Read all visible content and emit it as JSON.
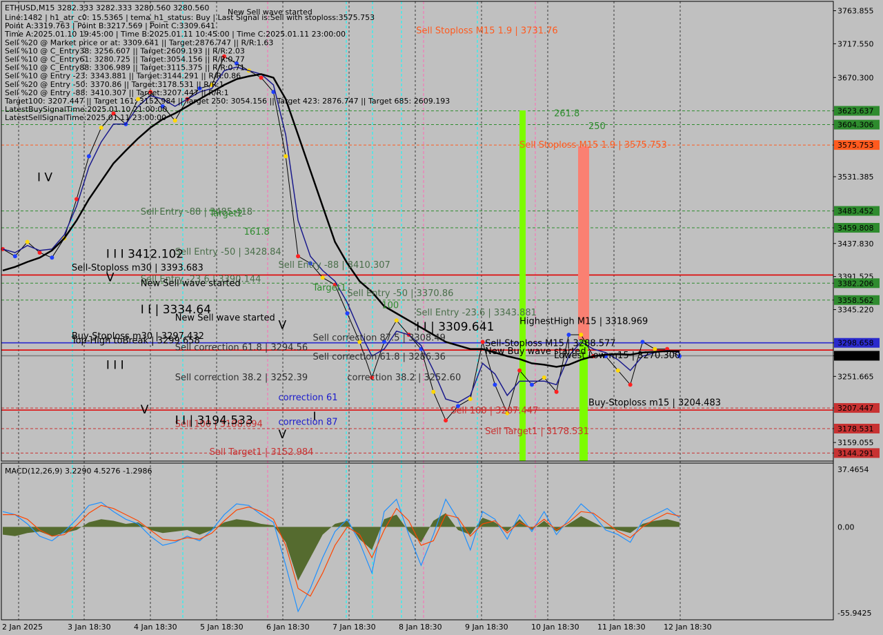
{
  "header": {
    "title": "ETHUSD,M15  3282.333 3282.333 3280.560 3280.560",
    "wave_label": "New Sell wave started",
    "info_lines": [
      "Line:1482 | h1_atr_c0: 15.5365 | tema_h1_status: Buy | Last Signal is:Sell with stoploss:3575.753",
      "Point A:3319.763 | Point B:3217.569 | Point C:3309.641",
      "Time A:2025.01.10 19:45:00 | Time B:2025.01.11 10:45:00 | Time C:2025.01.11 23:00:00",
      "Sell %20 @ Market price or at: 3309.641 || Target:2876.747 || R/R:1.63",
      "Sell %10 @ C_Entry38: 3256.607 || Target:2609.193 || R/R:2.03",
      "Sell %10 @ C_Entry61: 3280.725 || Target:3054.156 || R/R:0.77",
      "Sell %10 @ C_Entry88: 3306.989 || Target:3115.375 || R/R:0.71",
      "Sell %10 @ Entry -23: 3343.881 || Target:3144.291 || R/R:0.86",
      "Sell %20 @ Entry -50: 3370.86 || Target:3178.531 || R/R:1",
      "Sell %20 @ Entry -88: 3410.307 || Target:3207.447 || R/R:1",
      "Target100: 3207.447 || Target 161: 3152.984 || Target 250: 3054.156 || Target 423: 2876.747 || Target 685: 2609.193",
      "LatestBuySignalTime:2025.01.10 21:00:00",
      "LatestSellSignalTime:2025.01.11 23:00:00"
    ]
  },
  "price_scale": {
    "ticks": [
      "3763.855",
      "3717.550",
      "3670.300",
      "3623.637",
      "3604.306",
      "3575.753",
      "3531.385",
      "3483.452",
      "3459.808",
      "3437.830",
      "3391.525",
      "3382.206",
      "3358.562",
      "3345.220",
      "3298.658",
      "3280.560",
      "3251.665",
      "3207.447",
      "3178.531",
      "3159.055",
      "3144.291"
    ],
    "tags": [
      {
        "text": "3623.637",
        "color": "#2e8b2e"
      },
      {
        "text": "3604.306",
        "color": "#2e8b2e"
      },
      {
        "text": "3575.753",
        "color": "#ff5a1e"
      },
      {
        "text": "3483.452",
        "color": "#2e8b2e"
      },
      {
        "text": "3459.808",
        "color": "#2e8b2e"
      },
      {
        "text": "3382.206",
        "color": "#2e8b2e"
      },
      {
        "text": "3358.562",
        "color": "#2e8b2e"
      },
      {
        "text": "3298.658",
        "color": "#2a2acc"
      },
      {
        "text": "3280.560",
        "color": "#000000"
      },
      {
        "text": "3207.447",
        "color": "#c83232"
      },
      {
        "text": "3178.531",
        "color": "#c83232"
      },
      {
        "text": "3144.291",
        "color": "#c83232"
      }
    ]
  },
  "macd": {
    "title": "MACD(12,26,9) 3.2290 4.5276 -1.2986",
    "ticks": [
      "37.4654",
      "0.00",
      "-55.9425"
    ]
  },
  "chart_data": {
    "type": "line",
    "symbol": "ETHUSD",
    "timeframe": "M15",
    "x_labels": [
      "2 Jan 2025",
      "3 Jan 18:30",
      "4 Jan 18:30",
      "5 Jan 18:30",
      "6 Jan 18:30",
      "7 Jan 18:30",
      "8 Jan 18:30",
      "9 Jan 18:30",
      "10 Jan 18:30",
      "11 Jan 18:30",
      "12 Jan 18:30"
    ],
    "y_range": [
      3135,
      3775
    ],
    "series": [
      {
        "values": [
          3430,
          3420,
          3440,
          3425,
          3418,
          3445,
          3500,
          3560,
          3600,
          3620,
          3605,
          3640,
          3650,
          3630,
          3610,
          3640,
          3655,
          3660,
          3700,
          3690,
          3680,
          3670,
          3650,
          3560,
          3420,
          3410,
          3390,
          3380,
          3340,
          3300,
          3250,
          3300,
          3330,
          3310,
          3290,
          3230,
          3190,
          3210,
          3220,
          3300,
          3240,
          3200,
          3260,
          3240,
          3250,
          3230,
          3310,
          3310,
          3280,
          3280,
          3260,
          3240,
          3300,
          3290,
          3290,
          3280
        ]
      },
      {
        "color": "#1a1a8c",
        "values": [
          3430,
          3425,
          3435,
          3428,
          3430,
          3450,
          3490,
          3545,
          3580,
          3605,
          3605,
          3630,
          3645,
          3640,
          3630,
          3640,
          3650,
          3655,
          3680,
          3685,
          3680,
          3675,
          3660,
          3590,
          3470,
          3420,
          3400,
          3385,
          3355,
          3315,
          3280,
          3290,
          3315,
          3310,
          3295,
          3260,
          3220,
          3215,
          3225,
          3270,
          3255,
          3225,
          3245,
          3245,
          3245,
          3240,
          3280,
          3300,
          3290,
          3285,
          3275,
          3260,
          3280,
          3285,
          3288,
          3285
        ]
      },
      {
        "color": "#000000",
        "values": [
          3400,
          3405,
          3412,
          3418,
          3428,
          3445,
          3470,
          3500,
          3525,
          3550,
          3568,
          3585,
          3600,
          3612,
          3620,
          3630,
          3640,
          3650,
          3660,
          3668,
          3672,
          3675,
          3670,
          3640,
          3590,
          3540,
          3490,
          3440,
          3410,
          3385,
          3370,
          3350,
          3340,
          3330,
          3320,
          3310,
          3300,
          3295,
          3290,
          3290,
          3285,
          3280,
          3276,
          3270,
          3268,
          3265,
          3268,
          3275,
          3280,
          3282,
          3283,
          3282,
          3285,
          3286,
          3287,
          3287
        ]
      }
    ],
    "levels": [
      {
        "price": 3623.637,
        "color": "#2e8b2e",
        "style": "dash"
      },
      {
        "price": 3604.306,
        "color": "#2e8b2e",
        "style": "dash"
      },
      {
        "price": 3575.753,
        "color": "#ff5a1e",
        "style": "dash"
      },
      {
        "price": 3483.452,
        "color": "#2e8b2e",
        "style": "dash"
      },
      {
        "price": 3459.808,
        "color": "#2e8b2e",
        "style": "dash"
      },
      {
        "price": 3393.683,
        "color": "#e00000",
        "style": "solid"
      },
      {
        "price": 3382.206,
        "color": "#2e8b2e",
        "style": "dash"
      },
      {
        "price": 3358.562,
        "color": "#2e8b2e",
        "style": "dash"
      },
      {
        "price": 3298.658,
        "color": "#2a2acc",
        "style": "solid"
      },
      {
        "price": 3288.577,
        "color": "#e00000",
        "style": "solid"
      },
      {
        "price": 3280.56,
        "color": "#808080",
        "style": "solid"
      },
      {
        "price": 3207.447,
        "color": "#c83232",
        "style": "dash"
      },
      {
        "price": 3204.483,
        "color": "#e00000",
        "style": "solid"
      },
      {
        "price": 3178.531,
        "color": "#c83232",
        "style": "dash"
      },
      {
        "price": 3144.291,
        "color": "#c83232",
        "style": "dash"
      }
    ],
    "annotations": [
      {
        "text": "Sell Stoploss M15 1.9 | 3731.76",
        "color": "#ff5a1e",
        "x_index": 12,
        "price": 3731.76
      },
      {
        "text": "Sell Stoploss M15 1.9 | 3575.753",
        "color": "#ff5a1e",
        "x_index": 15,
        "price": 3572
      },
      {
        "text": "261.8",
        "color": "#2e8b2e",
        "x_index": 16,
        "price": 3616
      },
      {
        "text": "250",
        "color": "#2e8b2e",
        "x_index": 17,
        "price": 3598
      },
      {
        "text": "Sell Entry -88 | 3485.418",
        "color": "#4a6e4a",
        "x_index": 4,
        "price": 3478
      },
      {
        "text": "Target2",
        "color": "#2e8b2e",
        "x_index": 6,
        "price": 3476
      },
      {
        "text": "161.8",
        "color": "#2e8b2e",
        "x_index": 7,
        "price": 3450
      },
      {
        "text": "Sell Entry -50 | 3428.84",
        "color": "#4a6e4a",
        "x_index": 5,
        "price": 3422
      },
      {
        "text": "Sell Entry -88 | 3410.307",
        "color": "#4a6e4a",
        "x_index": 8,
        "price": 3404
      },
      {
        "text": "Sell Entry -23.6 | 3390.144",
        "color": "#4a6e4a",
        "x_index": 4,
        "price": 3384
      },
      {
        "text": "Target1",
        "color": "#2e8b2e",
        "x_index": 9,
        "price": 3372
      },
      {
        "text": "Sell Entry -50 | 3370.86",
        "color": "#4a6e4a",
        "x_index": 10,
        "price": 3364
      },
      {
        "text": "100",
        "color": "#2e8b2e",
        "x_index": 11,
        "price": 3347
      },
      {
        "text": "Sell Entry -23.6 | 3343.881",
        "color": "#4a6e4a",
        "x_index": 12,
        "price": 3337
      },
      {
        "text": "Sell-Stoploss m30 | 3393.683",
        "color": "#000000",
        "x_index": 2,
        "price": 3400
      },
      {
        "text": "Buy-Stoploss m30 | 3297.432",
        "color": "#000000",
        "x_index": 2,
        "price": 3304
      },
      {
        "text": "Sell-Stoploss M15 | 3288.577",
        "color": "#000000",
        "x_index": 14,
        "price": 3294
      },
      {
        "text": "HighestHigh   M15 | 3318.969",
        "color": "#000000",
        "x_index": 15,
        "price": 3325
      },
      {
        "text": "Lowest Low  m15 | 3270.300",
        "color": "#000000",
        "x_index": 16,
        "price": 3277
      },
      {
        "text": "Buy-Stoploss m15 | 3204.483",
        "color": "#000000",
        "x_index": 17,
        "price": 3211
      },
      {
        "text": "Sell 100 | 3207.447",
        "color": "#c83232",
        "x_index": 13,
        "price": 3200
      },
      {
        "text": "Sell Target1 | 3178.531",
        "color": "#c83232",
        "x_index": 14,
        "price": 3171
      },
      {
        "text": "Sell 100 | 3188.694",
        "color": "#c83232",
        "x_index": 5,
        "price": 3181
      },
      {
        "text": "Sell Target1 | 3152.984",
        "color": "#c83232",
        "x_index": 6,
        "price": 3142
      },
      {
        "text": "I I I 3412.102",
        "color": "#000000",
        "x_index": 3,
        "price": 3418
      },
      {
        "text": "I I | 3334.64",
        "color": "#000000",
        "x_index": 4,
        "price": 3340
      },
      {
        "text": "I I | 3309.641",
        "color": "#000000",
        "x_index": 12,
        "price": 3316
      },
      {
        "text": "I I | 3194.533",
        "color": "#1a1acc",
        "x_index": 5,
        "price": 3185
      },
      {
        "text": "I V",
        "color": "#1a1acc",
        "x_index": 1,
        "price": 3525
      },
      {
        "text": "V",
        "color": "#000000",
        "x_index": 3,
        "price": 3385
      },
      {
        "text": "I I I",
        "color": "#000000",
        "x_index": 3,
        "price": 3262
      },
      {
        "text": "V",
        "color": "#000000",
        "x_index": 4,
        "price": 3200
      },
      {
        "text": "I",
        "color": "#000000",
        "x_index": 5,
        "price": 3185
      },
      {
        "text": "V",
        "color": "#000000",
        "x_index": 8,
        "price": 3318
      },
      {
        "text": "V",
        "color": "#000000",
        "x_index": 8,
        "price": 3165
      },
      {
        "text": "I",
        "color": "#000000",
        "x_index": 9,
        "price": 3190
      },
      {
        "text": "New Sell wave started",
        "color": "#000000",
        "x_index": 4,
        "price": 3378
      },
      {
        "text": "New Sell wave started",
        "color": "#000000",
        "x_index": 5,
        "price": 3330
      },
      {
        "text": "Sell correction 61.8 | 3294.56",
        "color": "#303030",
        "x_index": 5,
        "price": 3288
      },
      {
        "text": "Sell correction 38.2 | 3252.39",
        "color": "#303030",
        "x_index": 5,
        "price": 3246
      },
      {
        "text": "Sell correction 87.5 | 3308.49",
        "color": "#303030",
        "x_index": 9,
        "price": 3302
      },
      {
        "text": "Sell correction 61.8 | 3286.36",
        "color": "#303030",
        "x_index": 9,
        "price": 3275
      },
      {
        "text": "correction 38.2 | 3252.60",
        "color": "#303030",
        "x_index": 10,
        "price": 3246
      },
      {
        "text": "correction 61",
        "color": "#1a1acc",
        "x_index": 8,
        "price": 3218
      },
      {
        "text": "correction 87",
        "color": "#1a1acc",
        "x_index": 8,
        "price": 3184
      },
      {
        "text": "New Buy wave started",
        "color": "#000000",
        "x_index": 14,
        "price": 3283
      },
      {
        "text": "Top-High toBreak | 3299.658",
        "color": "#000000",
        "x_index": 2,
        "price": 3298
      }
    ],
    "macd_hist": [
      -5,
      -6,
      -4,
      -3,
      -6,
      -4,
      -2,
      3,
      5,
      4,
      2,
      3,
      -2,
      -4,
      -3,
      -2,
      -5,
      -2,
      3,
      5,
      4,
      2,
      1,
      -10,
      -35,
      -20,
      -5,
      2,
      4,
      -8,
      -15,
      5,
      8,
      -3,
      -10,
      4,
      9,
      -2,
      -5,
      6,
      3,
      -3,
      5,
      -2,
      4,
      -3,
      2,
      7,
      3,
      -1,
      -2,
      -4,
      2,
      4,
      5,
      3
    ],
    "macd_line": [
      10,
      8,
      2,
      -6,
      -9,
      -3,
      5,
      14,
      16,
      10,
      5,
      2,
      -6,
      -12,
      -10,
      -6,
      -9,
      -2,
      8,
      15,
      14,
      8,
      3,
      -25,
      -55,
      -40,
      -20,
      -3,
      5,
      -10,
      -30,
      10,
      18,
      -5,
      -25,
      -5,
      18,
      5,
      -15,
      10,
      5,
      -8,
      8,
      -3,
      10,
      -5,
      5,
      15,
      8,
      -2,
      -5,
      -10,
      4,
      8,
      12,
      6
    ],
    "macd_signal": [
      8,
      8,
      5,
      -2,
      -6,
      -5,
      1,
      9,
      14,
      12,
      8,
      4,
      -2,
      -8,
      -9,
      -7,
      -8,
      -4,
      4,
      11,
      13,
      10,
      5,
      -12,
      -40,
      -45,
      -30,
      -12,
      0,
      -5,
      -20,
      -2,
      12,
      4,
      -12,
      -9,
      8,
      6,
      -6,
      2,
      4,
      -4,
      3,
      -1,
      5,
      -2,
      3,
      10,
      9,
      3,
      -3,
      -7,
      0,
      5,
      9,
      7
    ]
  }
}
